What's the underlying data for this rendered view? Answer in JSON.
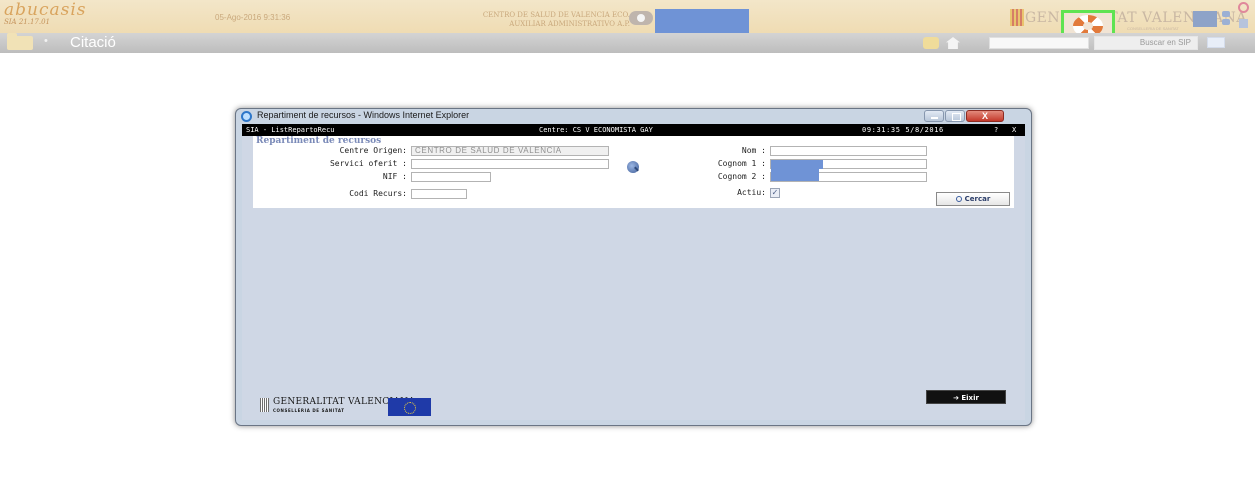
{
  "banner": {
    "logo_text": "abucasis",
    "logo_version": "SIA 21.17.01",
    "datetime": "05-Ago-2016 9:31:36",
    "center_line1": "CENTRO DE SALUD DE VALENCIA ECO.",
    "center_line2": "AUXILIAR ADMINISTRATIVO A.P.",
    "org_name": "GENERALITAT VALENCIANA",
    "org_sub": "CONSELLERIA DE SANITAT"
  },
  "title_bar": {
    "page_title": "Citació",
    "separator": "•",
    "sip_search_placeholder": "",
    "sip_button_label": "Buscar en SIP"
  },
  "window": {
    "title": "Repartiment de recursos - Windows Internet Explorer",
    "close_label": "X",
    "sia_app": "SIA - ListRepartoRecu",
    "sia_centre": "Centre: CS V ECONOMISTA GAY",
    "sia_datetime": "09:31:35 5/8/2016",
    "sia_help": "?",
    "sia_close": "X"
  },
  "form": {
    "heading": "Repartiment de recursos",
    "centre_origen_label": "Centre Origen:",
    "centre_origen_value": "CENTRO DE SALUD DE VALENCIA",
    "servici_oferit_label": "Servici oferit :",
    "servici_oferit_value": "",
    "nif_label": "NIF :",
    "nif_value": "",
    "codi_recurs_label": "Codi Recurs:",
    "codi_recurs_value": "",
    "nom_label": "Nom :",
    "nom_value": "",
    "cognom1_label": "Cognom 1 :",
    "cognom2_label": "Cognom 2 :",
    "actiu_label": "Actiu:",
    "actiu_checked": true,
    "actiu_mark": "✓",
    "cercar_label": "Cercar",
    "eixir_label": "Eixir"
  },
  "footer": {
    "org_name": "GENERALITAT VALENCIANA",
    "org_sub": "CONSELLERIA DE SANITAT"
  },
  "colors": {
    "banner_bg": "#f3e6c9",
    "title_bar_bg": "#c8c8c8",
    "highlight_green": "#5fe352",
    "redaction_blue": "#6f93d6",
    "window_frame": "#c9d5e3",
    "heading_blue": "#7a8ab8"
  },
  "icons": [
    "lifebuoy-icon",
    "user-icon",
    "folder-icon",
    "home-icon",
    "search-icon",
    "ie-logo-icon",
    "close-icon"
  ]
}
